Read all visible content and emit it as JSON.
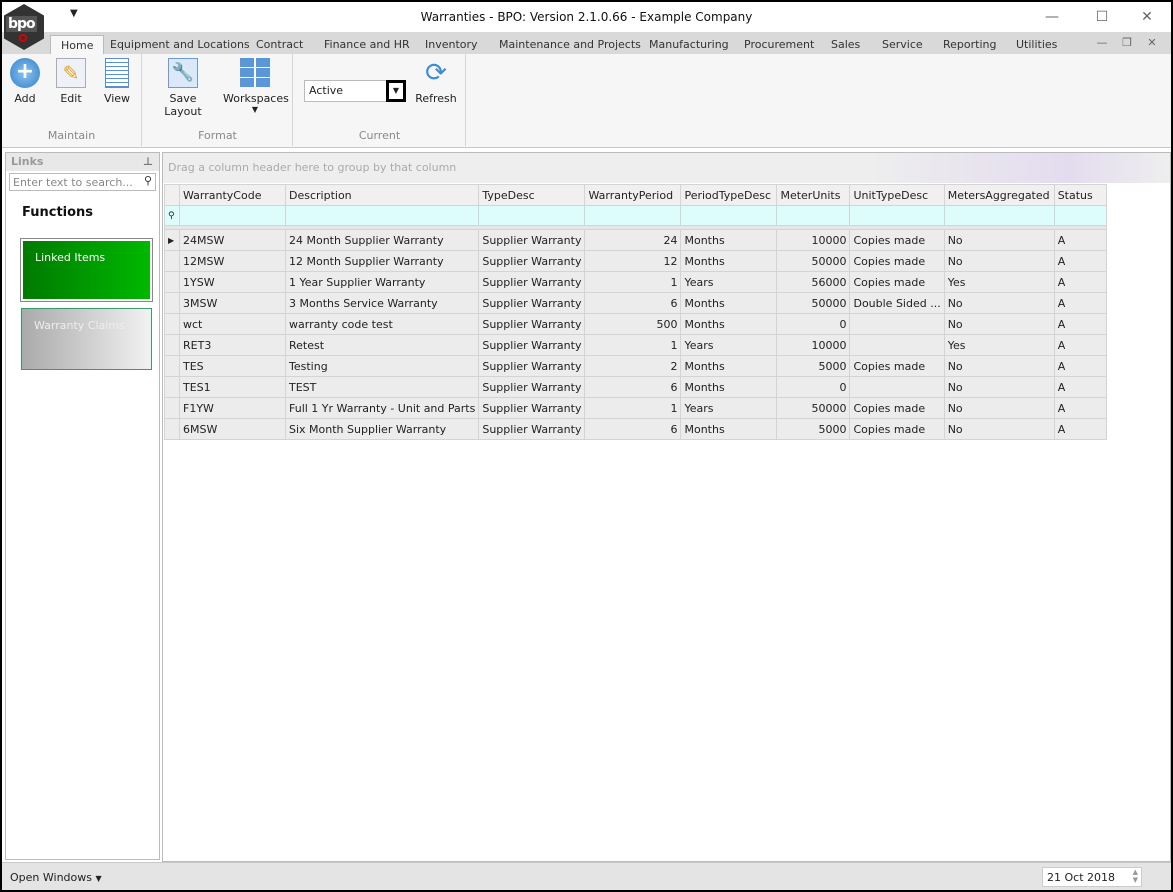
{
  "window": {
    "title": "Warranties - BPO: Version 2.1.0.66 - Example Company",
    "logo": "bpo"
  },
  "tabs": [
    "Home",
    "Equipment and Locations",
    "Contract",
    "Finance and HR",
    "Inventory",
    "Maintenance and Projects",
    "Manufacturing",
    "Procurement",
    "Sales",
    "Service",
    "Reporting",
    "Utilities"
  ],
  "ribbon": {
    "maintain": {
      "label": "Maintain",
      "add": "Add",
      "edit": "Edit",
      "view": "View"
    },
    "format": {
      "label": "Format",
      "save_layout": "Save Layout",
      "workspaces": "Workspaces"
    },
    "current": {
      "label": "Current",
      "filter_value": "Active",
      "refresh": "Refresh"
    }
  },
  "links": {
    "title": "Links",
    "search_placeholder": "Enter text to search...",
    "functions": "Functions",
    "items": [
      "Linked Items",
      "Warranty Claims"
    ]
  },
  "grid": {
    "group_hint": "Drag a column header here to group by that column",
    "columns": [
      "WarrantyCode",
      "Description",
      "TypeDesc",
      "WarrantyPeriod",
      "PeriodTypeDesc",
      "MeterUnits",
      "UnitTypeDesc",
      "MetersAggregated",
      "Status"
    ],
    "rows": [
      [
        "24MSW",
        "24 Month Supplier Warranty",
        "Supplier Warranty",
        "24",
        "Months",
        "10000",
        "Copies made",
        "No",
        "A"
      ],
      [
        "12MSW",
        "12 Month Supplier Warranty",
        "Supplier Warranty",
        "12",
        "Months",
        "50000",
        "Copies made",
        "No",
        "A"
      ],
      [
        "1YSW",
        "1 Year Supplier Warranty",
        "Supplier Warranty",
        "1",
        "Years",
        "56000",
        "Copies made",
        "Yes",
        "A"
      ],
      [
        "3MSW",
        "3 Months Service Warranty",
        "Supplier Warranty",
        "6",
        "Months",
        "50000",
        "Double Sided ...",
        "No",
        "A"
      ],
      [
        "wct",
        "warranty code test",
        "Supplier Warranty",
        "500",
        "Months",
        "0",
        "",
        "No",
        "A"
      ],
      [
        "RET3",
        "Retest",
        "Supplier Warranty",
        "1",
        "Years",
        "10000",
        "",
        "Yes",
        "A"
      ],
      [
        "TES",
        "Testing",
        "Supplier Warranty",
        "2",
        "Months",
        "5000",
        "Copies made",
        "No",
        "A"
      ],
      [
        "TES1",
        "TEST",
        "Supplier Warranty",
        "6",
        "Months",
        "0",
        "",
        "No",
        "A"
      ],
      [
        "F1YW",
        "Full 1 Yr Warranty - Unit and Parts",
        "Supplier Warranty",
        "1",
        "Years",
        "50000",
        "Copies made",
        "No",
        "A"
      ],
      [
        "6MSW",
        "Six Month Supplier Warranty",
        "Supplier Warranty",
        "6",
        "Months",
        "5000",
        "Copies made",
        "No",
        "A"
      ]
    ]
  },
  "statusbar": {
    "open_windows": "Open Windows",
    "date": "21 Oct 2018"
  }
}
